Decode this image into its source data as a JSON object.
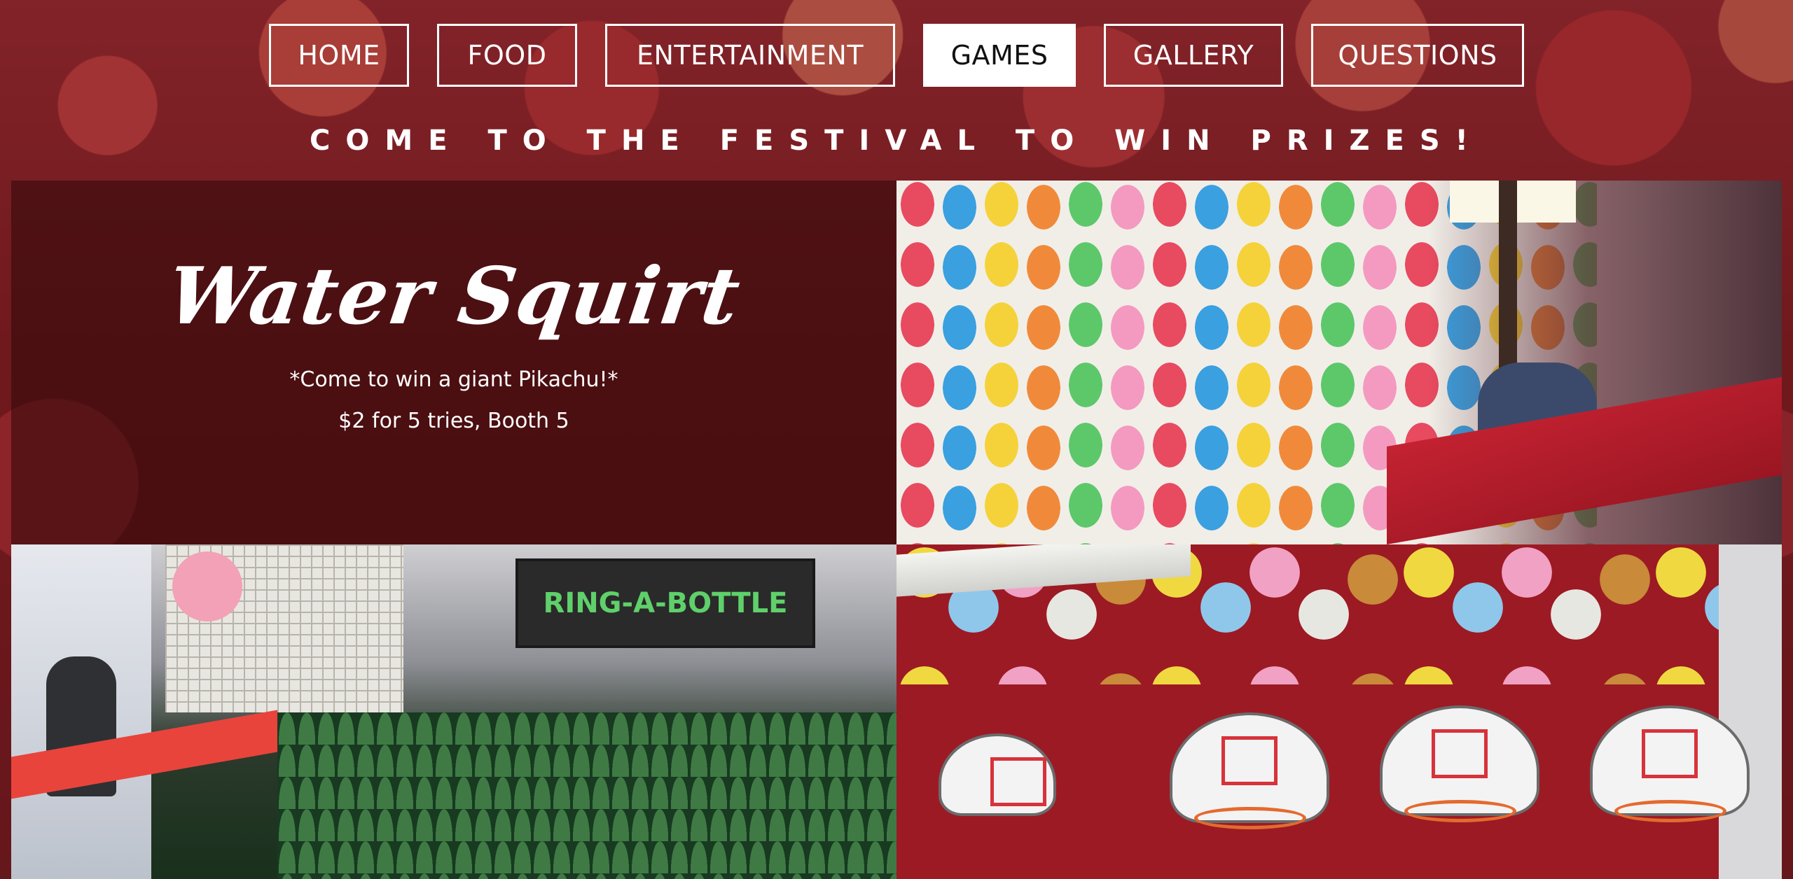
{
  "nav": {
    "items": [
      {
        "label": "HOME",
        "active": false
      },
      {
        "label": "FOOD",
        "active": false
      },
      {
        "label": "ENTERTAINMENT",
        "active": false
      },
      {
        "label": "GAMES",
        "active": true
      },
      {
        "label": "GALLERY",
        "active": false
      },
      {
        "label": "QUESTIONS",
        "active": false
      }
    ]
  },
  "tagline": "COME TO THE FESTIVAL TO WIN PRIZES!",
  "game": {
    "title": "Water Squirt",
    "description": "*Come to win a giant Pikachu!*",
    "price": "$2 for 5 tries, Booth 5"
  },
  "photos": {
    "balloon_sign": "",
    "ring_sign": "RING-A-BOTTLE"
  },
  "colors": {
    "active_nav_bg": "#ffffff",
    "active_nav_text": "#111111",
    "accent_red": "#9c1a24"
  }
}
